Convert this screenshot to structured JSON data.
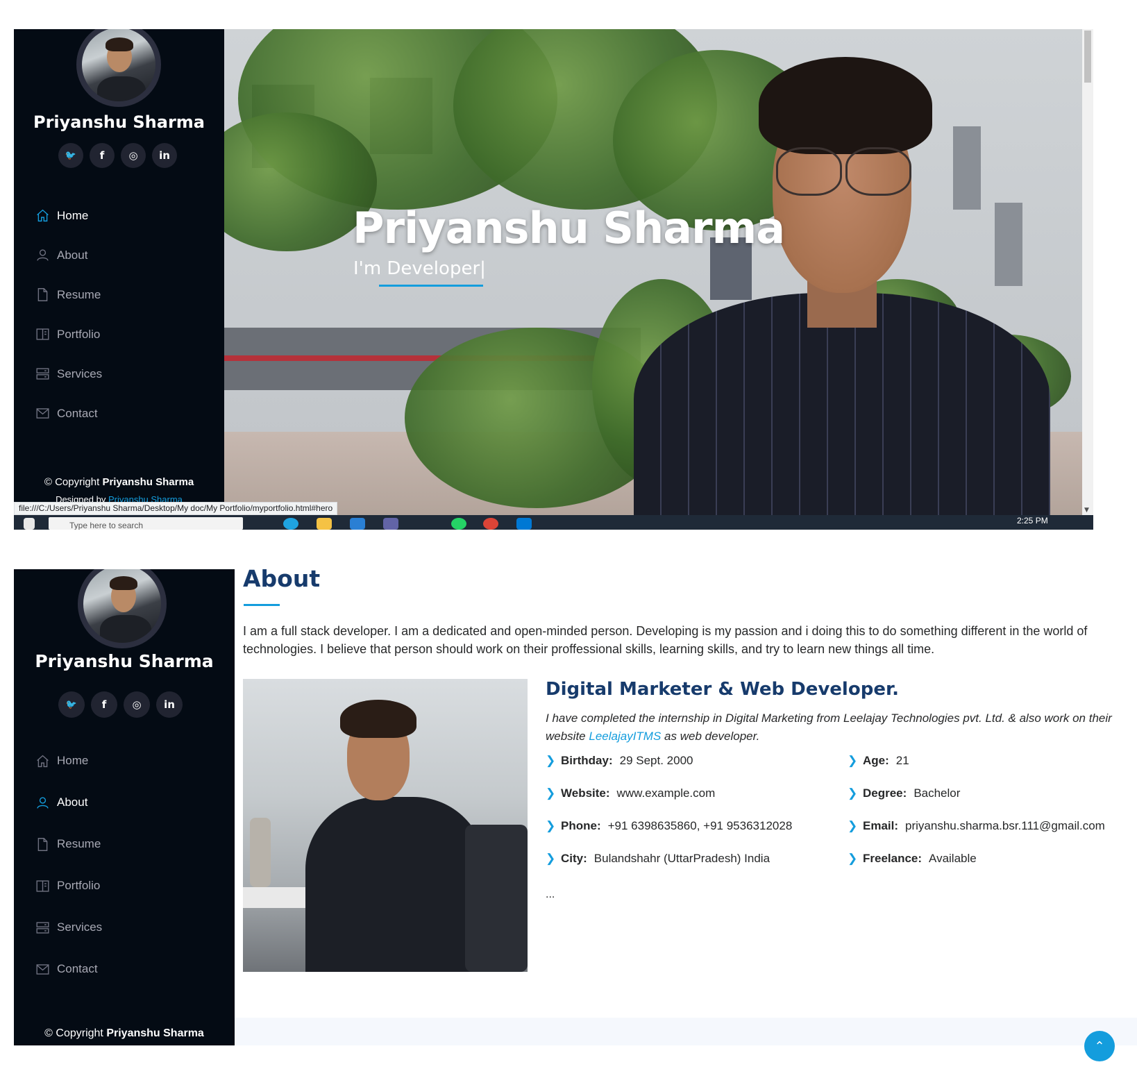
{
  "profile": {
    "name": "Priyanshu Sharma",
    "socials": [
      {
        "icon": "twitter-icon",
        "glyph": "🐦"
      },
      {
        "icon": "facebook-icon",
        "glyph": "f"
      },
      {
        "icon": "instagram-icon",
        "glyph": "◎"
      },
      {
        "icon": "linkedin-icon",
        "glyph": "in"
      }
    ]
  },
  "nav": [
    {
      "label": "Home",
      "icon": "home-icon"
    },
    {
      "label": "About",
      "icon": "person-icon"
    },
    {
      "label": "Resume",
      "icon": "file-icon"
    },
    {
      "label": "Portfolio",
      "icon": "book-icon"
    },
    {
      "label": "Services",
      "icon": "server-icon"
    },
    {
      "label": "Contact",
      "icon": "envelope-icon"
    }
  ],
  "footer": {
    "copyright_prefix": "© Copyright",
    "copyright_name": "Priyanshu Sharma",
    "designed_prefix": "Designed by",
    "designed_name": "Priyanshu Sharma"
  },
  "hero": {
    "title": "Priyanshu Sharma",
    "subtitle": "I'm Developer|"
  },
  "browser": {
    "status_url": "file:///C:/Users/Priyanshu Sharma/Desktop/My doc/My Portfolio/myportfolio.html#hero",
    "search_placeholder": "Type here to search",
    "clock": "2:25 PM"
  },
  "about": {
    "title": "About",
    "description": "I am a full stack developer. I am a dedicated and open-minded person. Developing is my passion and i doing this to do something different in the world of technologies. I believe that person should work on their proffessional skills, learning skills, and try to learn new things all time.",
    "card_title": "Digital Marketer & Web Developer.",
    "card_desc_before": "I have completed the internship in Digital Marketing from Leelajay Technologies pvt. Ltd. & also work on their website ",
    "card_link": "LeelajayITMS",
    "card_desc_after": " as web developer.",
    "info_left": [
      {
        "label": "Birthday:",
        "value": "29 Sept. 2000"
      },
      {
        "label": "Website:",
        "value": "www.example.com"
      },
      {
        "label": "Phone:",
        "value": "+91 6398635860, +91 9536312028"
      },
      {
        "label": "City:",
        "value": "Bulandshahr (UttarPradesh) India"
      }
    ],
    "info_right": [
      {
        "label": "Age:",
        "value": "21"
      },
      {
        "label": "Degree:",
        "value": "Bachelor"
      },
      {
        "label": "Email:",
        "value": "priyanshu.sharma.bsr.111@gmail.com"
      },
      {
        "label": "Freelance:",
        "value": "Available"
      }
    ],
    "ellipsis": "..."
  },
  "colors": {
    "sidebar_bg": "#040b14",
    "accent": "#149ddd",
    "heading": "#173b6c"
  }
}
